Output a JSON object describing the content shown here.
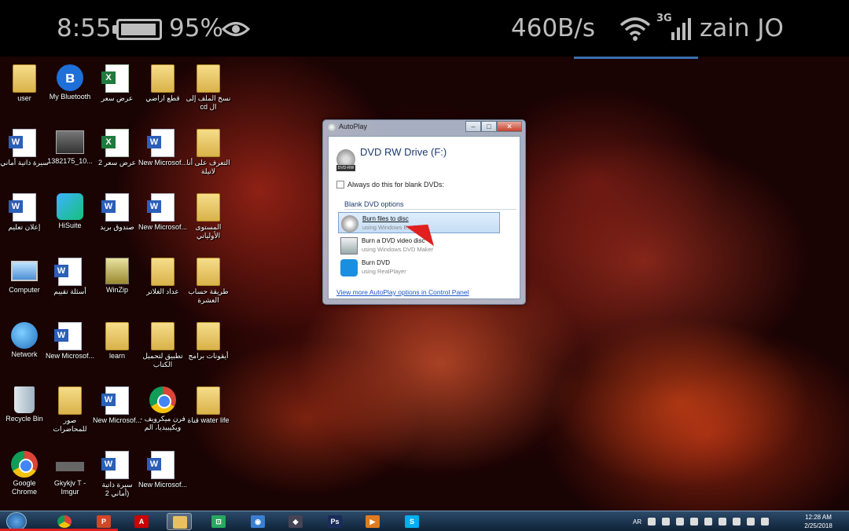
{
  "status_bar": {
    "time": "8:55",
    "battery_pct": "95%",
    "battery_level": 0.95,
    "net_speed": "460B/s",
    "network_type": "3G",
    "carrier": "zain JO",
    "icons": [
      "battery-icon",
      "eye-icon",
      "wifi-icon",
      "signal-icon"
    ]
  },
  "desktop": {
    "icons": [
      {
        "label": "user",
        "icon": "folder"
      },
      {
        "label": "My Bluetooth",
        "icon": "bluetooth"
      },
      {
        "label": "عرض سعر",
        "icon": "excel"
      },
      {
        "label": "قطع اراضي",
        "icon": "folder"
      },
      {
        "label": "نسخ الملف إلى cd ال",
        "icon": "folder"
      },
      {
        "label": "سيرة ذاتية أماني",
        "icon": "word"
      },
      {
        "label": "1382175_10...",
        "icon": "photo"
      },
      {
        "label": "عرض سعر 2",
        "icon": "excel"
      },
      {
        "label": "New Microsof...",
        "icon": "word"
      },
      {
        "label": "التعرف على أنا لاتيلة",
        "icon": "folder"
      },
      {
        "label": "إعلان تعليم",
        "icon": "word"
      },
      {
        "label": "HiSuite",
        "icon": "hisuite"
      },
      {
        "label": "صندوق بريد",
        "icon": "word"
      },
      {
        "label": "New Microsof...",
        "icon": "word"
      },
      {
        "label": "المستوى الأولياني",
        "icon": "folder"
      },
      {
        "label": "Computer",
        "icon": "computer"
      },
      {
        "label": "أسئلة تقييم",
        "icon": "word"
      },
      {
        "label": "WinZip",
        "icon": "zip"
      },
      {
        "label": "عداد الغلاتر",
        "icon": "folder"
      },
      {
        "label": "طريقة حساب العشرة",
        "icon": "folder"
      },
      {
        "label": "Network",
        "icon": "globe"
      },
      {
        "label": "New Microsof...",
        "icon": "word"
      },
      {
        "label": "learn",
        "icon": "folder"
      },
      {
        "label": "تطبيق لتحميل الكتاب",
        "icon": "folder"
      },
      {
        "label": "أيقونات برامج",
        "icon": "folder"
      },
      {
        "label": "Recycle Bin",
        "icon": "bin"
      },
      {
        "label": "صور للمحاضرات",
        "icon": "folder"
      },
      {
        "label": "New Microsof...",
        "icon": "word"
      },
      {
        "label": "- فرن ميكرويف ويكيبيديا، الم",
        "icon": "chrome"
      },
      {
        "label": "قناة water life",
        "icon": "folder"
      },
      {
        "label": "Google Chrome",
        "icon": "chrome"
      },
      {
        "label": "Gkykjv T - Imgur",
        "icon": "gray"
      },
      {
        "label": "سيرة ذاتية (أماني 2",
        "icon": "word"
      },
      {
        "label": "New Microsof...",
        "icon": "word"
      }
    ]
  },
  "autoplay": {
    "title": "AutoPlay",
    "drive_name": "DVD RW Drive (F:)",
    "drive_badge": "DVD-RW",
    "always_label": "Always do this for blank DVDs:",
    "section_heading": "Blank DVD options",
    "options": [
      {
        "title": "Burn files to disc",
        "subtitle": "using Windows Explorer",
        "icon": "cd-icon",
        "selected": true
      },
      {
        "title": "Burn a DVD video disc",
        "subtitle": "using Windows DVD Maker",
        "icon": "dvd-maker-icon",
        "selected": false
      },
      {
        "title": "Burn DVD",
        "subtitle": "using RealPlayer",
        "icon": "realplayer-icon",
        "selected": false
      }
    ],
    "link": "View more AutoPlay options in Control Panel",
    "window_buttons": {
      "minimize": "–",
      "maximize": "□",
      "close": "✕"
    }
  },
  "taskbar": {
    "apps": [
      {
        "name": "chrome",
        "label": ""
      },
      {
        "name": "powerpoint",
        "label": "P"
      },
      {
        "name": "acrobat",
        "label": "A"
      },
      {
        "name": "explorer",
        "label": ""
      },
      {
        "name": "screen-recorder",
        "label": "⊡"
      },
      {
        "name": "camera",
        "label": "◉"
      },
      {
        "name": "app",
        "label": "◆"
      },
      {
        "name": "photoshop",
        "label": "Ps"
      },
      {
        "name": "media-player",
        "label": "▶"
      },
      {
        "name": "skype",
        "label": "S"
      }
    ],
    "tray_language": "AR",
    "clock_time": "12:28 AM",
    "clock_date": "2/25/2018"
  }
}
